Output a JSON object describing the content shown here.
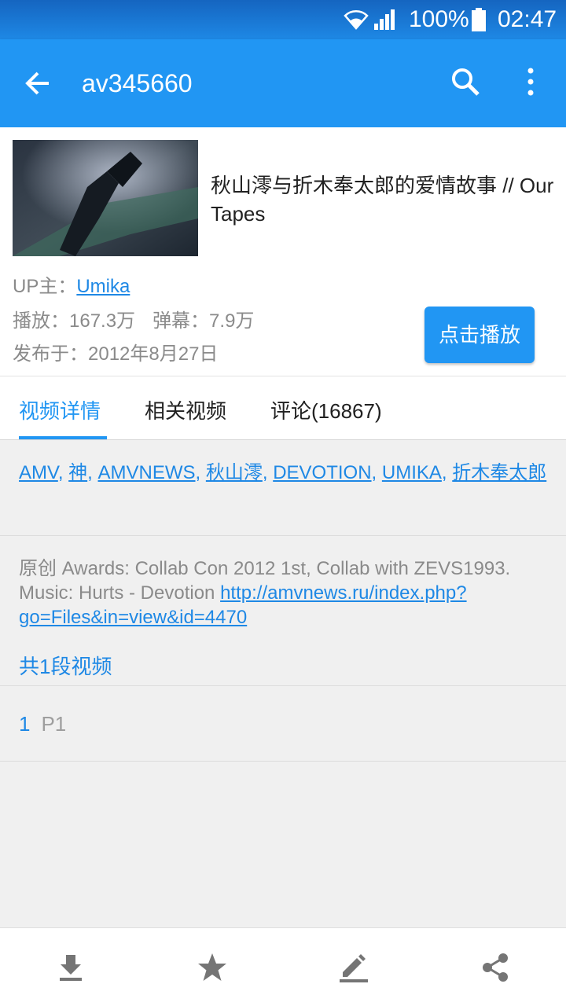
{
  "statusbar": {
    "battery": "100%",
    "time": "02:47",
    "icons": [
      "wifi-icon",
      "signal-icon",
      "battery-icon"
    ]
  },
  "appbar": {
    "title": "av345660",
    "icons": [
      "back-arrow-icon",
      "search-icon",
      "more-vert-icon"
    ]
  },
  "video": {
    "title": "秋山澪与折木奉太郎的爱情故事 // Our Tapes",
    "up_label": "UP主：",
    "up_name": "Umika",
    "plays": "播放：167.3万",
    "danmaku": "弹幕：7.9万",
    "published": "发布于：2012年8月27日",
    "play_button": "点击播放"
  },
  "tabs": [
    {
      "label": "视频详情",
      "active": true
    },
    {
      "label": "相关视频",
      "active": false
    },
    {
      "label": "评论(16867)",
      "active": false
    }
  ],
  "tags": [
    "AMV",
    "神",
    "AMVNEWS",
    "秋山澪",
    "DEVOTION",
    "UMIKA",
    "折木奉太郎"
  ],
  "description": {
    "text": "原创 Awards: Collab Con 2012 1st, Collab with ZEVS1993. Music: Hurts - Devotion ",
    "link": "http://amvnews.ru/index.php?go=Files&in=view&id=4470"
  },
  "parts": {
    "count_label": "共1段视频",
    "items": [
      {
        "number": "1",
        "name": "P1"
      }
    ]
  },
  "bottombar": {
    "icons": [
      "download-icon",
      "star-icon",
      "edit-icon",
      "share-icon"
    ]
  },
  "colors": {
    "primary": "#2196f3",
    "link": "#1e88e5",
    "background": "#f0f0f0"
  }
}
